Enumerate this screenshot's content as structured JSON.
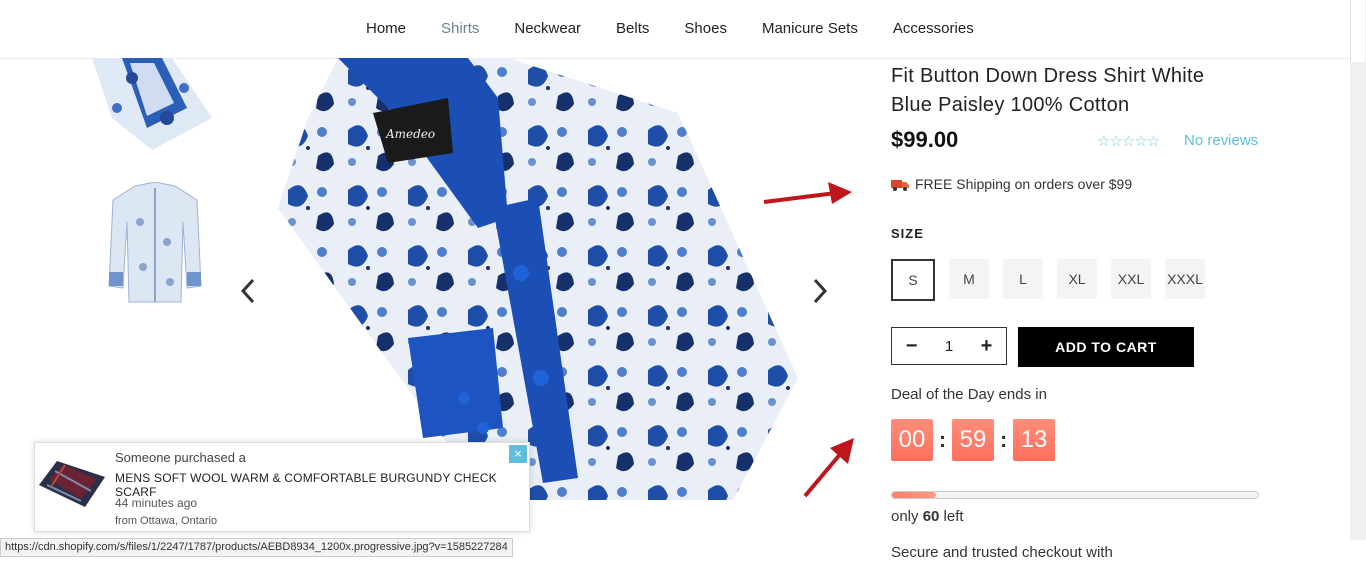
{
  "nav": {
    "items": [
      {
        "label": "Home"
      },
      {
        "label": "Shirts",
        "active": true
      },
      {
        "label": "Neckwear"
      },
      {
        "label": "Belts"
      },
      {
        "label": "Shoes"
      },
      {
        "label": "Manicure Sets"
      },
      {
        "label": "Accessories"
      }
    ]
  },
  "gallery": {
    "prev_icon": "chevron-left-icon",
    "next_icon": "chevron-right-icon"
  },
  "product": {
    "title_line1": "Fit Button Down Dress Shirt White",
    "title_line2": "Blue Paisley 100% Cotton",
    "price": "$99.00",
    "stars": "☆☆☆☆☆",
    "reviews": "No reviews",
    "shipping": "FREE Shipping on orders over $99",
    "size_label": "SIZE",
    "sizes": [
      "S",
      "M",
      "L",
      "XL",
      "XXL",
      "XXXL"
    ],
    "selected_size": "S",
    "qty_minus": "−",
    "qty_value": "1",
    "qty_plus": "+",
    "add_to_cart": "ADD TO CART",
    "deal_text": "Deal of the Day ends in",
    "timer": {
      "hours": "00",
      "minutes": "59",
      "seconds": "13",
      "sep": ":"
    },
    "stock_progress": 0.12,
    "stock_prefix": "only ",
    "stock_count": "60",
    "stock_suffix": " left",
    "secure": "Secure and trusted checkout with"
  },
  "popup": {
    "line1": "Someone purchased a",
    "product": "MENS SOFT WOOL WARM & COMFORTABLE BURGUNDY CHECK SCARF",
    "time": "44 minutes ago",
    "location": "from Ottawa, Ontario",
    "close": "×"
  },
  "status_url": "https://cdn.shopify.com/s/files/1/2247/1787/products/AEBD8934_1200x.progressive.jpg?v=1585227284",
  "colors": {
    "accent": "#5fbedb",
    "timer": "#ff7a66",
    "arrow": "#c0161b"
  }
}
